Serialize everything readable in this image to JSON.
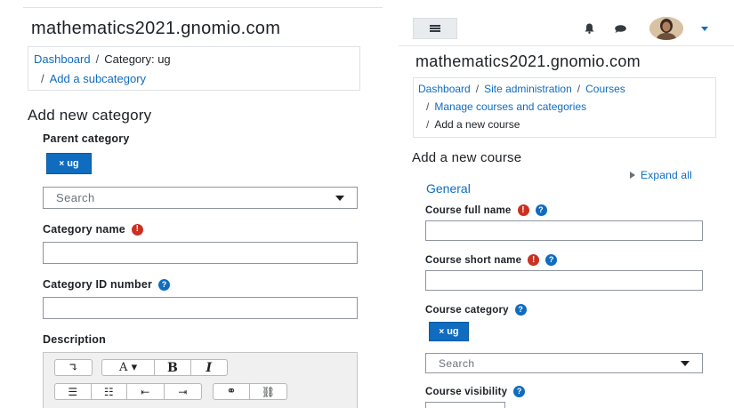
{
  "left": {
    "site_title": "mathematics2021.gnomio.com",
    "breadcrumb": {
      "dashboard": "Dashboard",
      "sep": "/",
      "current": "Category: ug",
      "add_subcategory": "Add a subcategory"
    },
    "heading": "Add new category",
    "parent_category_label": "Parent category",
    "tag": {
      "x": "×",
      "label": "ug"
    },
    "search_placeholder": "Search",
    "category_name_label": "Category name",
    "category_id_label": "Category ID number",
    "description_label": "Description",
    "required_glyph": "!",
    "help_glyph": "?",
    "editor": {
      "row1": [
        "↴",
        "A ▾",
        "B",
        "I"
      ],
      "row2": [
        "☰",
        "☷",
        "⇤",
        "⇥",
        "⚭",
        "⛓"
      ]
    }
  },
  "right": {
    "site_title": "mathematics2021.gnomio.com",
    "breadcrumb": {
      "dashboard": "Dashboard",
      "sep": "/",
      "site_admin": "Site administration",
      "courses": "Courses",
      "manage": "Manage courses and categories",
      "current": "Add a new course"
    },
    "heading": "Add a new course",
    "expand_all": "Expand all",
    "section_general": "General",
    "course_full_name_label": "Course full name",
    "course_short_name_label": "Course short name",
    "course_category_label": "Course category",
    "tag": {
      "x": "×",
      "label": "ug"
    },
    "search_placeholder": "Search",
    "course_visibility_label": "Course visibility",
    "required_glyph": "!",
    "help_glyph": "?"
  },
  "colors": {
    "primary": "#0f6cbf",
    "required": "#ca3120",
    "text": "#1d2125",
    "border": "#8f959e"
  }
}
